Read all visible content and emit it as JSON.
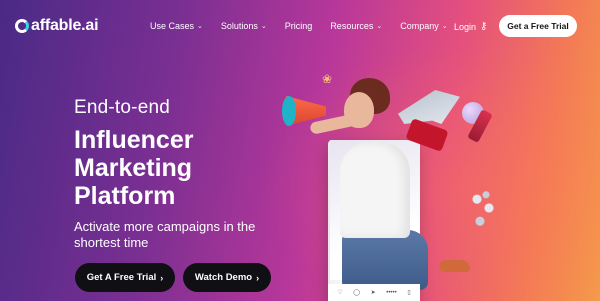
{
  "brand": {
    "name": "affable.ai"
  },
  "nav": {
    "items": [
      {
        "label": "Use Cases",
        "dropdown": true
      },
      {
        "label": "Solutions",
        "dropdown": true
      },
      {
        "label": "Pricing",
        "dropdown": false
      },
      {
        "label": "Resources",
        "dropdown": true
      },
      {
        "label": "Company",
        "dropdown": true
      }
    ],
    "login": "Login",
    "cta": "Get a Free Trial"
  },
  "hero": {
    "eyebrow": "End-to-end",
    "headline": [
      "Influencer",
      "Marketing",
      "Platform"
    ],
    "subtitle": "Activate more campaigns in the shortest time",
    "cta_primary": "Get A Free Trial",
    "cta_secondary": "Watch Demo"
  },
  "icons": {
    "login": "key-icon",
    "chevron": "chevron-down-icon",
    "cta_arrow": "chevron-right-icon"
  },
  "colors": {
    "gradient_start": "#4a2a86",
    "gradient_mid": "#b8379a",
    "gradient_end": "#f59a4a",
    "button_dark": "#0f0f14",
    "button_light": "#ffffff"
  }
}
